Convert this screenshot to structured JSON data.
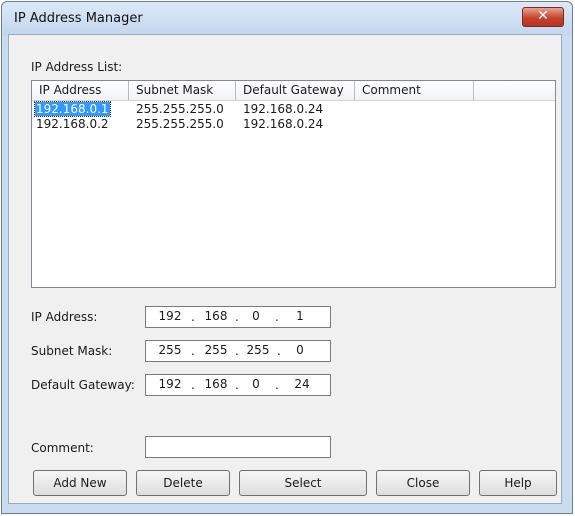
{
  "window": {
    "title": "IP Address Manager",
    "close_glyph": "✕"
  },
  "list": {
    "label": "IP Address List:",
    "columns": [
      "IP Address",
      "Subnet Mask",
      "Default Gateway",
      "Comment"
    ],
    "rows": [
      {
        "ip": "192.168.0.1",
        "mask": "255.255.255.0",
        "gateway": "192.168.0.24",
        "comment": "",
        "selected": true
      },
      {
        "ip": "192.168.0.2",
        "mask": "255.255.255.0",
        "gateway": "192.168.0.24",
        "comment": "",
        "selected": false
      }
    ]
  },
  "form": {
    "ip_label": "IP Address:",
    "ip": [
      "192",
      "168",
      "0",
      "1"
    ],
    "mask_label": "Subnet Mask:",
    "mask": [
      "255",
      "255",
      "255",
      "0"
    ],
    "gateway_label": "Default Gateway:",
    "gateway": [
      "192",
      "168",
      "0",
      "24"
    ],
    "comment_label": "Comment:",
    "comment_value": ""
  },
  "buttons": {
    "add_new": "Add New",
    "delete": "Delete",
    "select": "Select",
    "close": "Close",
    "help": "Help"
  },
  "icons": {
    "close": "close-icon"
  }
}
